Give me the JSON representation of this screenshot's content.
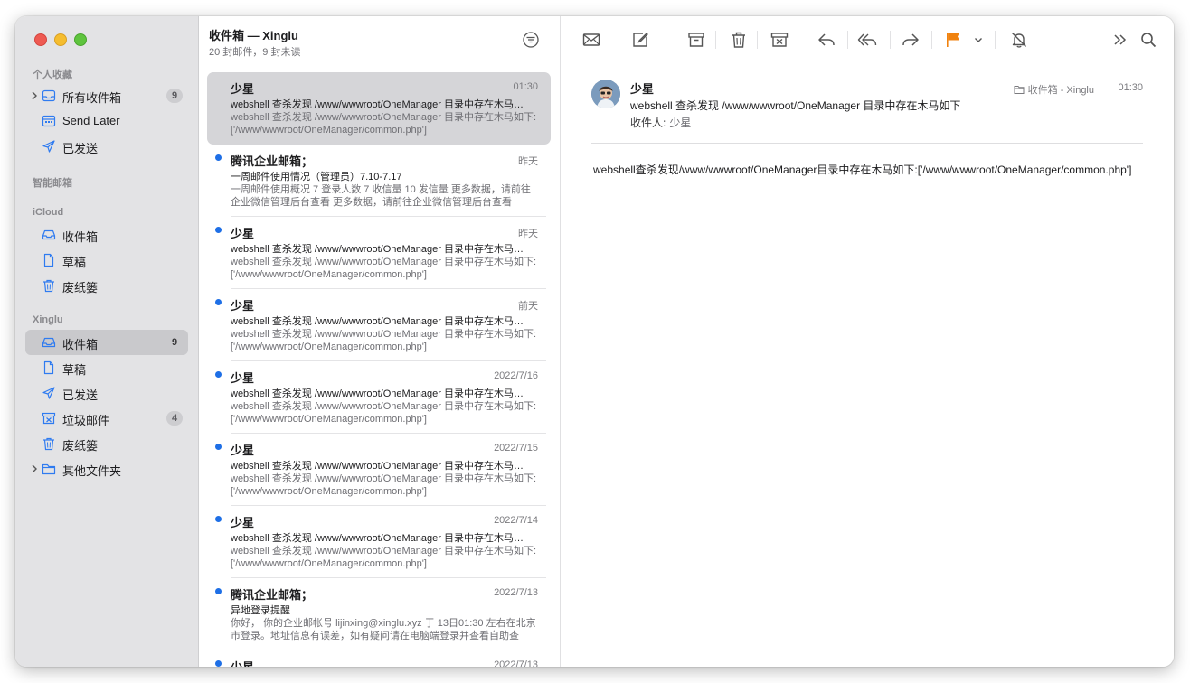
{
  "sidebar": {
    "sections": {
      "favorites": "个人收藏",
      "smart": "智能邮箱",
      "icloud": "iCloud",
      "account": "Xinglu"
    },
    "favorites": [
      {
        "label": "所有收件箱",
        "badge": "9",
        "icon": "tray-icon"
      },
      {
        "label": "Send Later",
        "icon": "calendar-icon"
      },
      {
        "label": "已发送",
        "icon": "paperplane-icon"
      }
    ],
    "icloud": [
      {
        "label": "收件箱",
        "icon": "tray-icon"
      },
      {
        "label": "草稿",
        "icon": "doc-icon"
      },
      {
        "label": "废纸篓",
        "icon": "trash-icon"
      }
    ],
    "account": [
      {
        "label": "收件箱",
        "badge": "9",
        "icon": "tray-icon",
        "selected": true
      },
      {
        "label": "草稿",
        "icon": "doc-icon"
      },
      {
        "label": "已发送",
        "icon": "paperplane-icon"
      },
      {
        "label": "垃圾邮件",
        "badge": "4",
        "icon": "junk-icon"
      },
      {
        "label": "废纸篓",
        "icon": "trash-icon"
      },
      {
        "label": "其他文件夹",
        "icon": "folder-icon"
      }
    ]
  },
  "list": {
    "title": "收件箱 — Xinglu",
    "subtitle": "20 封邮件，9 封未读",
    "messages": [
      {
        "sender": "少星",
        "date": "01:30",
        "subject": "webshell 查杀发现 /www/wwwroot/OneManager 目录中存在木马如下:['/www/wwwroot/OneManager/common.php']",
        "preview": "webshell 查杀发现 /www/wwwroot/OneManager 目录中存在木马如下:['/www/wwwroot/OneManager/common.php']",
        "unread": false,
        "selected": true
      },
      {
        "sender": "腾讯企业邮箱；",
        "date": "昨天",
        "subject": "一周邮件使用情况（管理员）7.10-7.17",
        "preview": "一周邮件使用概况 7 登录人数 7 收信量 10 发信量 更多数据，请前往企业微信管理后台查看 更多数据，请前往企业微信管理后台查看",
        "unread": true
      },
      {
        "sender": "少星",
        "date": "昨天",
        "subject": "webshell 查杀发现 /www/wwwroot/OneManager 目录中存在木马如下:['/www/wwwroot/OneManager/common.php']",
        "preview": "webshell 查杀发现 /www/wwwroot/OneManager 目录中存在木马如下:['/www/wwwroot/OneManager/common.php']",
        "unread": true
      },
      {
        "sender": "少星",
        "date": "前天",
        "subject": "webshell 查杀发现 /www/wwwroot/OneManager 目录中存在木马如下:['/www/wwwroot/OneManager/common.php']",
        "preview": "webshell 查杀发现 /www/wwwroot/OneManager 目录中存在木马如下:['/www/wwwroot/OneManager/common.php']",
        "unread": true
      },
      {
        "sender": "少星",
        "date": "2022/7/16",
        "subject": "webshell 查杀发现 /www/wwwroot/OneManager 目录中存在木马如下:['/www/wwwroot/OneManager/common.php']",
        "preview": "webshell 查杀发现 /www/wwwroot/OneManager 目录中存在木马如下:['/www/wwwroot/OneManager/common.php']",
        "unread": true
      },
      {
        "sender": "少星",
        "date": "2022/7/15",
        "subject": "webshell 查杀发现 /www/wwwroot/OneManager 目录中存在木马如下:['/www/wwwroot/OneManager/common.php']",
        "preview": "webshell 查杀发现 /www/wwwroot/OneManager 目录中存在木马如下:['/www/wwwroot/OneManager/common.php']",
        "unread": true
      },
      {
        "sender": "少星",
        "date": "2022/7/14",
        "subject": "webshell 查杀发现 /www/wwwroot/OneManager 目录中存在木马如下:['/www/wwwroot/OneManager/common.php']",
        "preview": "webshell 查杀发现 /www/wwwroot/OneManager 目录中存在木马如下:['/www/wwwroot/OneManager/common.php']",
        "unread": true
      },
      {
        "sender": "腾讯企业邮箱；",
        "date": "2022/7/13",
        "subject": "异地登录提醒",
        "preview": "你好， 你的企业邮帐号 lijinxing@xinglu.xyz 于 13日01:30 左右在北京市登录。地址信息有误差，如有疑问请在电脑端登录并查看自助查询。",
        "unread": true
      },
      {
        "sender": "少星",
        "date": "2022/7/13",
        "subject": "",
        "preview": "",
        "unread": true
      }
    ]
  },
  "toolbar": {
    "icons": [
      "envelope-icon",
      "compose-icon",
      "archive-icon",
      "trash-icon",
      "junk-icon",
      "reply-icon",
      "reply-all-icon",
      "forward-icon",
      "flag-icon",
      "chevron-down-icon",
      "mute-icon",
      "more-icon",
      "search-icon"
    ],
    "flag_color": "#f0820f"
  },
  "message": {
    "sender": "少星",
    "subject": "webshell 查杀发现 /www/wwwroot/OneManager 目录中存在木马如下",
    "to_label": "收件人:",
    "to_value": "少星",
    "mailbox": "收件箱 - Xinglu",
    "time": "01:30",
    "body": "webshell查杀发现/www/wwwroot/OneManager目录中存在木马如下:['/www/wwwroot/OneManager/common.php']"
  },
  "colors": {
    "accent": "#1e6fe6",
    "sidebar_bg": "#e3e3e5",
    "selection": "#d5d5d8"
  }
}
